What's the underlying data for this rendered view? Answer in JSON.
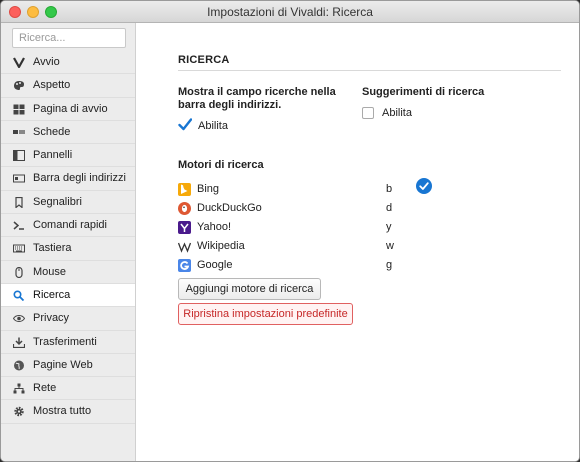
{
  "window": {
    "title": "Impostazioni di Vivaldi: Ricerca"
  },
  "sidebar": {
    "search_placeholder": "Ricerca...",
    "items": [
      {
        "label": "Avvio",
        "icon": "vivaldi-logo-icon"
      },
      {
        "label": "Aspetto",
        "icon": "paint-palette-icon"
      },
      {
        "label": "Pagina di avvio",
        "icon": "start-page-grid-icon"
      },
      {
        "label": "Schede",
        "icon": "tabs-icon"
      },
      {
        "label": "Pannelli",
        "icon": "panels-icon"
      },
      {
        "label": "Barra degli indirizzi",
        "icon": "address-bar-icon"
      },
      {
        "label": "Segnalibri",
        "icon": "bookmark-icon"
      },
      {
        "label": "Comandi rapidi",
        "icon": "quick-commands-icon"
      },
      {
        "label": "Tastiera",
        "icon": "keyboard-icon"
      },
      {
        "label": "Mouse",
        "icon": "mouse-icon"
      },
      {
        "label": "Ricerca",
        "icon": "search-icon",
        "active": true
      },
      {
        "label": "Privacy",
        "icon": "eye-icon"
      },
      {
        "label": "Trasferimenti",
        "icon": "download-icon"
      },
      {
        "label": "Pagine Web",
        "icon": "globe-icon"
      },
      {
        "label": "Rete",
        "icon": "network-icon"
      },
      {
        "label": "Mostra tutto",
        "icon": "gear-icon"
      }
    ]
  },
  "main": {
    "section_title": "RICERCA",
    "address_bar_search": {
      "label": "Mostra il campo ricerche nella barra degli indirizzi.",
      "checkbox_label": "Abilita",
      "checked": true
    },
    "suggestions": {
      "label": "Suggerimenti di ricerca",
      "checkbox_label": "Abilita",
      "checked": false
    },
    "engines_title": "Motori di ricerca",
    "engines": [
      {
        "name": "Bing",
        "key": "b",
        "icon": "bing-logo-icon",
        "color": "#f6a90a",
        "default": true
      },
      {
        "name": "DuckDuckGo",
        "key": "d",
        "icon": "duckduckgo-logo-icon",
        "color": "#de5833"
      },
      {
        "name": "Yahoo!",
        "key": "y",
        "icon": "yahoo-logo-icon",
        "color": "#4a1a8c"
      },
      {
        "name": "Wikipedia",
        "key": "w",
        "icon": "wikipedia-logo-icon",
        "color": "#333333"
      },
      {
        "name": "Google",
        "key": "g",
        "icon": "google-logo-icon",
        "color": "#4a86e8"
      }
    ],
    "add_button": "Aggiungi motore di ricerca",
    "reset_button": "Ripristina impostazioni predefinite"
  },
  "colors": {
    "accent": "#1876d2",
    "reset_red": "#c62828",
    "sidebar_bg": "#ececec"
  }
}
